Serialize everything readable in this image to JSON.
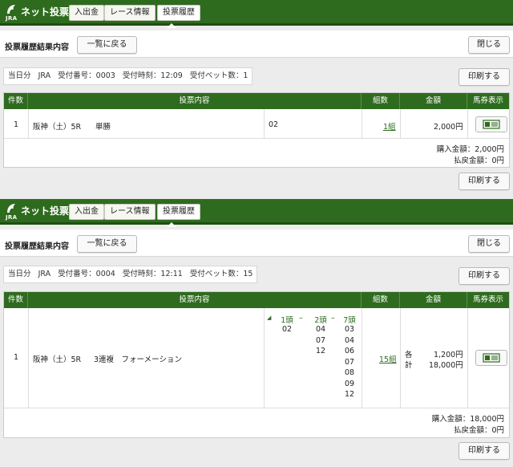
{
  "header": {
    "logo_mark": "JRA",
    "logo_text": "ネット投票",
    "nav": [
      "入出金",
      "レース情報",
      "投票履歴"
    ],
    "active_nav": "投票履歴"
  },
  "page": {
    "title": "投票履歴結果内容",
    "back_label": "一覧に戻る",
    "close_label": "閉じる",
    "print_label": "印刷する"
  },
  "columns": {
    "count": "件数",
    "content": "投票内容",
    "kumi": "組数",
    "amount": "金額",
    "ticket": "馬券表示"
  },
  "records": [
    {
      "info": {
        "day": "当日分",
        "org": "JRA",
        "receipt_no": "受付番号：0003",
        "receipt_time": "受付時刻：12:09",
        "bet_count": "受付ベット数：1"
      },
      "row": {
        "index": "1",
        "race": "阪神（土）5R",
        "bet_type": "単勝",
        "horses": "02",
        "kumi": "1組",
        "amount": "2,000円"
      },
      "totals": {
        "purchase": "購入金額：2,000円",
        "refund": "払戻金額：0円"
      }
    },
    {
      "info": {
        "day": "当日分",
        "org": "JRA",
        "receipt_no": "受付番号：0004",
        "receipt_time": "受付時刻：12:11",
        "bet_count": "受付ベット数：15"
      },
      "row": {
        "index": "1",
        "race": "阪神（土）5R",
        "bet_type": "3連複　フォーメーション",
        "formation_marker": "◢",
        "formation_header": [
          "1頭",
          "2頭",
          "7頭"
        ],
        "formation_dash": "–",
        "col1": [
          "02"
        ],
        "col2": [
          "04",
          "07",
          "12"
        ],
        "col3": [
          "03",
          "04",
          "06",
          "07",
          "08",
          "09",
          "12"
        ],
        "kumi": "15組",
        "each_label": "各",
        "total_label": "計",
        "each_amount": "1,200円",
        "total_amount": "18,000円"
      },
      "totals": {
        "purchase": "購入金額：18,000円",
        "refund": "払戻金額：0円"
      }
    }
  ],
  "colors": {
    "header_green": "#2e6b1e",
    "link_green": "#2e6b1e"
  }
}
